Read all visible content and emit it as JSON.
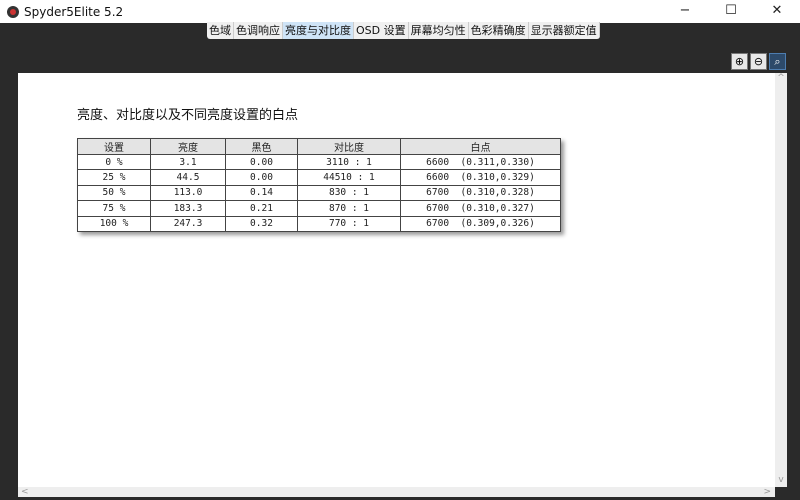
{
  "window": {
    "title": "Spyder5Elite 5.2",
    "minimize": "−",
    "maximize": "☐",
    "close": "✕"
  },
  "tabs": [
    {
      "label": "色域"
    },
    {
      "label": "色调响应"
    },
    {
      "label": "亮度与对比度",
      "active": true
    },
    {
      "label": "OSD 设置"
    },
    {
      "label": "屏幕均匀性"
    },
    {
      "label": "色彩精确度"
    },
    {
      "label": "显示器额定值"
    }
  ],
  "zoom": {
    "in": "⊕",
    "out": "⊖",
    "fit": "🔍"
  },
  "report": {
    "heading": "亮度、对比度以及不同亮度设置的白点",
    "columns": [
      "设置",
      "亮度",
      "黑色",
      "对比度",
      "白点"
    ],
    "rows": [
      [
        "0 %",
        "3.1",
        "0.00",
        "3110 : 1",
        "6600  (0.311,0.330)"
      ],
      [
        "25 %",
        "44.5",
        "0.00",
        "44510 : 1",
        "6600  (0.310,0.329)"
      ],
      [
        "50 %",
        "113.0",
        "0.14",
        "830 : 1",
        "6700  (0.310,0.328)"
      ],
      [
        "75 %",
        "183.3",
        "0.21",
        "870 : 1",
        "6700  (0.310,0.327)"
      ],
      [
        "100 %",
        "247.3",
        "0.32",
        "770 : 1",
        "6700  (0.309,0.326)"
      ]
    ]
  },
  "scroll": {
    "up": "^",
    "down": "v",
    "left": "<",
    "right": ">"
  }
}
